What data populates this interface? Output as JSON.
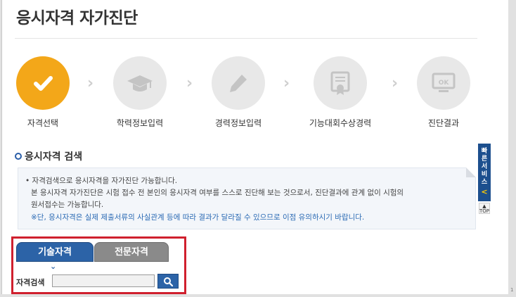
{
  "page": {
    "title": "응시자격 자가진단"
  },
  "steps": [
    {
      "label": "자격선택",
      "icon": "check-icon",
      "active": true
    },
    {
      "label": "학력정보입력",
      "icon": "graduation-cap-icon",
      "active": false
    },
    {
      "label": "경력정보입력",
      "icon": "pencil-icon",
      "active": false
    },
    {
      "label": "기능대회수상경력",
      "icon": "certificate-icon",
      "active": false
    },
    {
      "label": "진단결과",
      "icon": "ok-monitor-icon",
      "active": false
    }
  ],
  "step_arrow": "›",
  "section": {
    "title": "응시자격 검색"
  },
  "notice": {
    "line1": "• 자격검색으로 응시자격을 자가진단 가능합니다.",
    "line2": "본 응시자격 자가진단은 시험 접수 전 본인의 응시자격 여부를 스스로 진단해 보는 것으로서, 진단결과에 관계 없이 시험의",
    "line3": "원서접수는 가능합니다.",
    "line4": "※단, 응시자격은 실제 제출서류의 사실관계 등에 따라 결과가 달라질 수 있으므로 이점 유의하시기 바랍니다."
  },
  "quick_menu": {
    "label": "빠른서비스",
    "chevron": "<"
  },
  "top_button": {
    "arrow": "▲",
    "label": "TOP"
  },
  "tabs": [
    {
      "label": "기술자격",
      "active": true
    },
    {
      "label": "전문자격",
      "active": false
    }
  ],
  "tab_indicator": "⌄",
  "search": {
    "label": "자격검색",
    "value": "",
    "placeholder": "",
    "button_icon": "search-icon"
  },
  "edge_mark": "1",
  "colors": {
    "step_active": "#f3a719",
    "step_inactive": "#e8e8e8",
    "primary_blue": "#2c63a7",
    "highlight_red": "#d0202e"
  }
}
